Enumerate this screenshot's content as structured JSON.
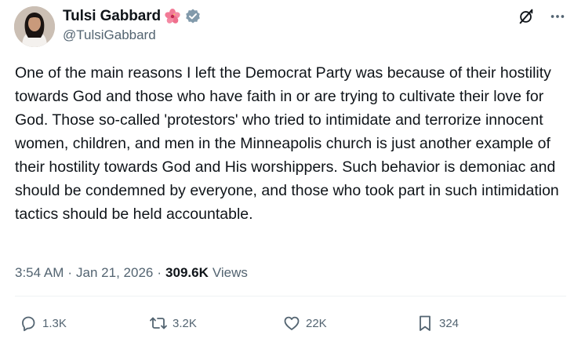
{
  "author": {
    "display_name": "Tulsi Gabbard",
    "emoji": "hibiscus-flower-icon",
    "verified": true,
    "handle": "@TulsiGabbard"
  },
  "tweet": {
    "text": "One of the main reasons I left the Democrat Party was because of their hostility towards God and those who have faith in or are trying to cultivate their love for God. Those so-called 'protestors' who tried to intimidate and terrorize innocent women, children, and men in the Minneapolis church is just another example of their hostility towards God and His worshippers. Such behavior is demoniac and should be condemned by everyone, and those who took part in such intimidation tactics should be held accountable.",
    "time": "3:54 AM",
    "separator": "·",
    "date": "Jan 21, 2026",
    "views_count": "309.6K",
    "views_label": "Views"
  },
  "actions": {
    "replies": "1.3K",
    "reposts": "3.2K",
    "likes": "22K",
    "bookmarks": "324"
  },
  "colors": {
    "text_primary": "#0f1419",
    "text_secondary": "#536471",
    "verified_badge": "#829aab",
    "divider": "#eff3f4"
  }
}
